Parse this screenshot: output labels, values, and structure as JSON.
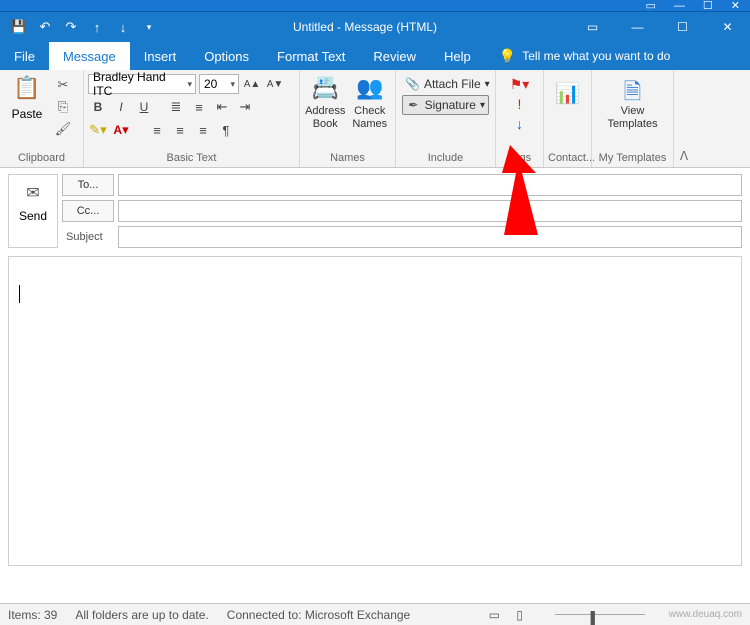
{
  "title": "Untitled - Message (HTML)",
  "tabs": {
    "file": "File",
    "message": "Message",
    "insert": "Insert",
    "options": "Options",
    "format": "Format Text",
    "review": "Review",
    "help": "Help",
    "tell": "Tell me what you want to do"
  },
  "ribbon": {
    "clipboard": {
      "paste": "Paste",
      "label": "Clipboard"
    },
    "basictext": {
      "font": "Bradley Hand ITC",
      "size": "20",
      "label": "Basic Text"
    },
    "names": {
      "address": "Address Book",
      "check": "Check Names",
      "label": "Names"
    },
    "include": {
      "attach": "Attach File",
      "signature": "Signature",
      "label": "Include"
    },
    "tags": {
      "label": "Tags"
    },
    "contact": {
      "label": "Contact..."
    },
    "mytpl": {
      "view": "View Templates",
      "label": "My Templates"
    }
  },
  "compose": {
    "send": "Send",
    "to": "To...",
    "cc": "Cc...",
    "subject": "Subject"
  },
  "status": {
    "items": "Items: 39",
    "folders": "All folders are up to date.",
    "connected": "Connected to: Microsoft Exchange"
  },
  "watermark": "www.deuaq.com"
}
